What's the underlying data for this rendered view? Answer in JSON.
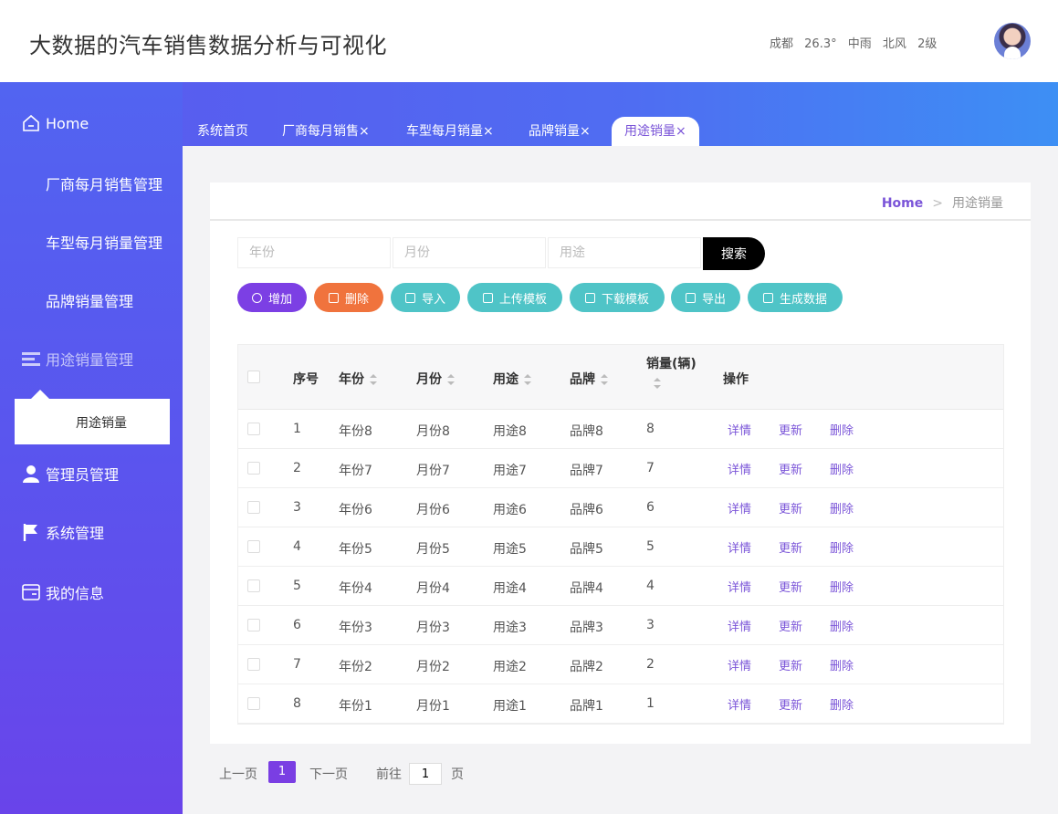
{
  "header": {
    "title": "大数据的汽车销售数据分析与可视化",
    "weather": {
      "city": "成都",
      "temp": "26.3°",
      "condition": "中雨",
      "wind_dir": "北风",
      "wind_level": "2级"
    }
  },
  "sidebar": {
    "items": [
      {
        "label": "Home",
        "icon": "home-icon"
      },
      {
        "label": "厂商每月销售管理",
        "icon": "grid-icon"
      },
      {
        "label": "车型每月销量管理",
        "icon": "grid-icon"
      },
      {
        "label": "品牌销量管理",
        "icon": "grid-icon"
      },
      {
        "label": "用途销量管理",
        "icon": "list-icon"
      },
      {
        "label": "管理员管理",
        "icon": "user-icon"
      },
      {
        "label": "系统管理",
        "icon": "flag-icon"
      },
      {
        "label": "我的信息",
        "icon": "card-icon"
      }
    ],
    "submenu_item": "用途销量"
  },
  "tabs": [
    {
      "label": "系统首页"
    },
    {
      "label": "厂商每月销售×"
    },
    {
      "label": "车型每月销量×"
    },
    {
      "label": "品牌销量×"
    },
    {
      "label": "用途销量×",
      "active": true
    }
  ],
  "breadcrumb": {
    "home": "Home",
    "sep": ">",
    "current": "用途销量"
  },
  "search": {
    "year_placeholder": "年份",
    "month_placeholder": "月份",
    "usage_placeholder": "用途",
    "button": "搜索"
  },
  "actions": {
    "add": "增加",
    "delete": "删除",
    "import": "导入",
    "upload_template": "上传模板",
    "download_template": "下载模板",
    "export": "导出",
    "generate": "生成数据"
  },
  "colors": {
    "accent": "#7a54d8",
    "add": "#7c3fe4",
    "delete": "#f0733d",
    "teal": "#4fc4c7"
  },
  "table": {
    "headers": {
      "index": "序号",
      "year": "年份",
      "month": "月份",
      "usage": "用途",
      "brand": "品牌",
      "sales": "销量(辆)",
      "ops": "操作"
    },
    "op_labels": {
      "detail": "详情",
      "update": "更新",
      "delete": "删除"
    },
    "rows": [
      {
        "index": "1",
        "year": "年份8",
        "month": "月份8",
        "usage": "用途8",
        "brand": "品牌8",
        "sales": "8"
      },
      {
        "index": "2",
        "year": "年份7",
        "month": "月份7",
        "usage": "用途7",
        "brand": "品牌7",
        "sales": "7"
      },
      {
        "index": "3",
        "year": "年份6",
        "month": "月份6",
        "usage": "用途6",
        "brand": "品牌6",
        "sales": "6"
      },
      {
        "index": "4",
        "year": "年份5",
        "month": "月份5",
        "usage": "用途5",
        "brand": "品牌5",
        "sales": "5"
      },
      {
        "index": "5",
        "year": "年份4",
        "month": "月份4",
        "usage": "用途4",
        "brand": "品牌4",
        "sales": "4"
      },
      {
        "index": "6",
        "year": "年份3",
        "month": "月份3",
        "usage": "用途3",
        "brand": "品牌3",
        "sales": "3"
      },
      {
        "index": "7",
        "year": "年份2",
        "month": "月份2",
        "usage": "用途2",
        "brand": "品牌2",
        "sales": "2"
      },
      {
        "index": "8",
        "year": "年份1",
        "month": "月份1",
        "usage": "用途1",
        "brand": "品牌1",
        "sales": "1"
      }
    ]
  },
  "pagination": {
    "prev": "上一页",
    "current": "1",
    "next": "下一页",
    "goto": "前往",
    "goto_value": "1",
    "page_suffix": "页"
  }
}
